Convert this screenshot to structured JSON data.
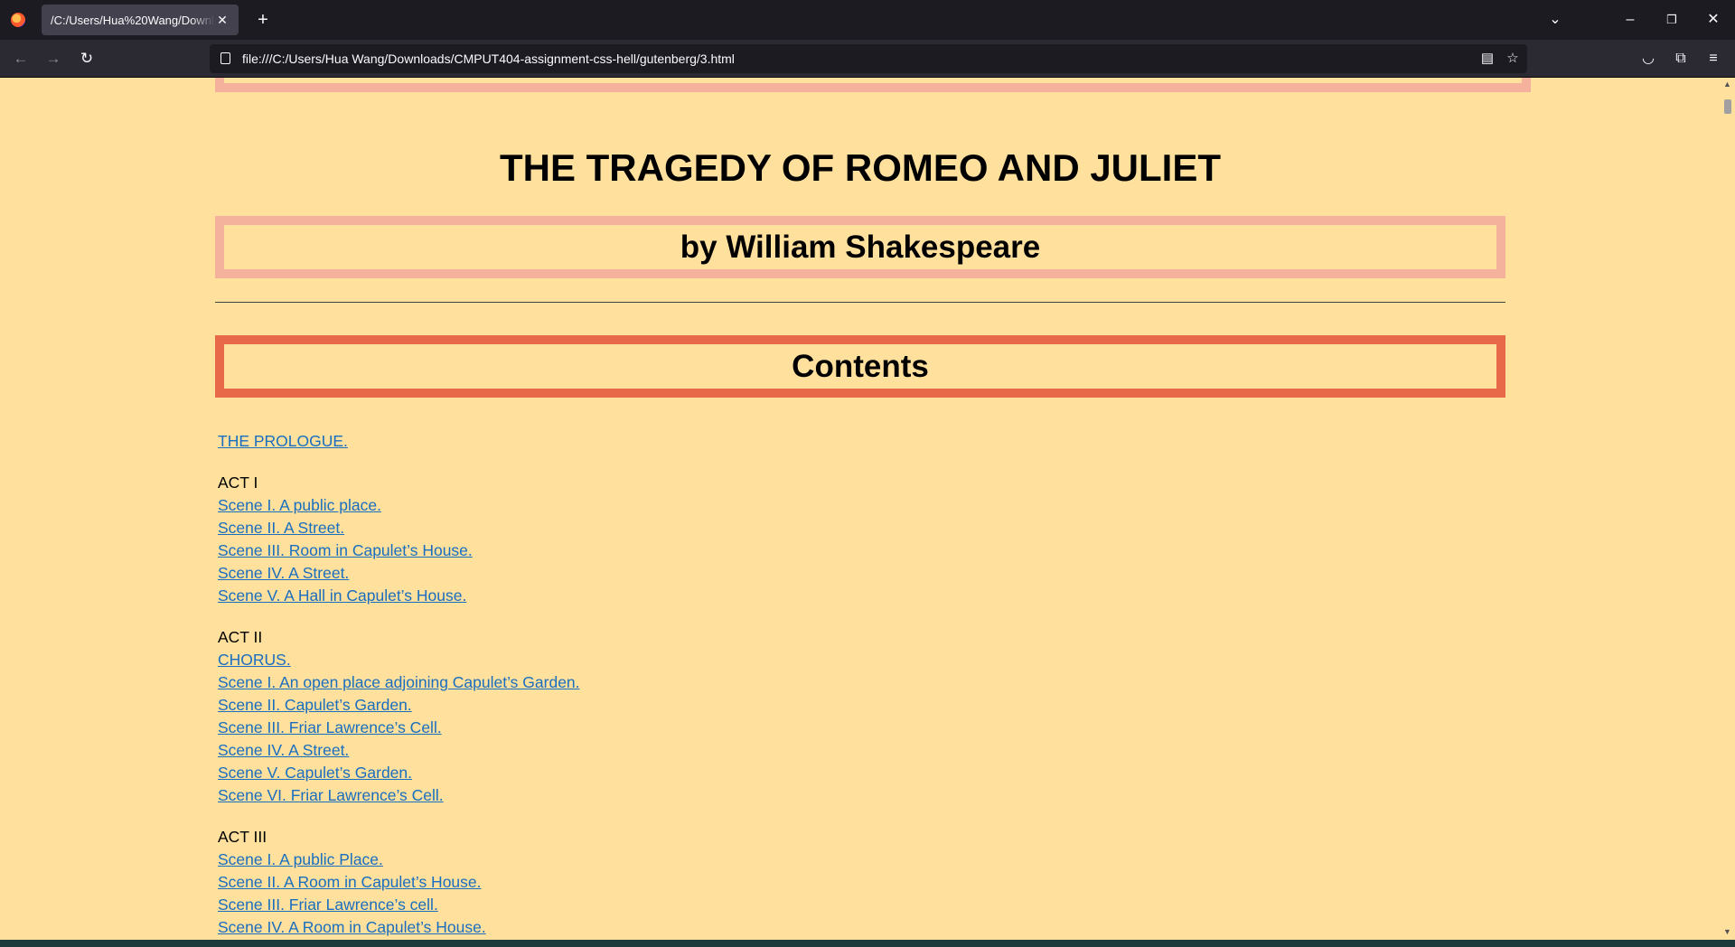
{
  "browser": {
    "tab_title": "/C:/Users/Hua%20Wang/Downloads/CMPUT404-assignment-css-hell/gutenberg/3.html",
    "tab_close": "✕",
    "new_tab": "+",
    "url": "file:///C:/Users/Hua Wang/Downloads/CMPUT404-assignment-css-hell/gutenberg/3.html",
    "icons": [
      "firefox-logo",
      "back-icon",
      "forward-icon",
      "reload-icon",
      "page-icon",
      "reader-view-icon",
      "bookmark-star-icon",
      "pocket-icon",
      "extensions-icon",
      "menu-icon",
      "list-tabs-icon",
      "minimize-icon",
      "restore-icon",
      "close-icon"
    ]
  },
  "page": {
    "title": "THE TRAGEDY OF ROMEO AND JULIET",
    "author": "by William Shakespeare",
    "contents_heading": "Contents",
    "prologue": "THE PROLOGUE.",
    "acts": [
      {
        "label": "ACT I",
        "scenes": [
          "Scene I. A public place.",
          "Scene II. A Street.",
          "Scene III. Room in Capulet’s House.",
          "Scene IV. A Street.",
          "Scene V. A Hall in Capulet’s House."
        ]
      },
      {
        "label": "ACT II",
        "scenes": [
          "CHORUS.",
          "Scene I. An open place adjoining Capulet’s Garden.",
          "Scene II. Capulet’s Garden.",
          "Scene III. Friar Lawrence’s Cell.",
          "Scene IV. A Street.",
          "Scene V. Capulet’s Garden.",
          "Scene VI. Friar Lawrence’s Cell."
        ]
      },
      {
        "label": "ACT III",
        "scenes": [
          "Scene I. A public Place.",
          "Scene II. A Room in Capulet’s House.",
          "Scene III. Friar Lawrence’s cell.",
          "Scene IV. A Room in Capulet’s House."
        ]
      }
    ]
  },
  "colors": {
    "page_background": "#ffe09c",
    "box_border_light": "#f4b19b",
    "box_border_accent": "#e8694a",
    "link": "#1a6ec0"
  }
}
